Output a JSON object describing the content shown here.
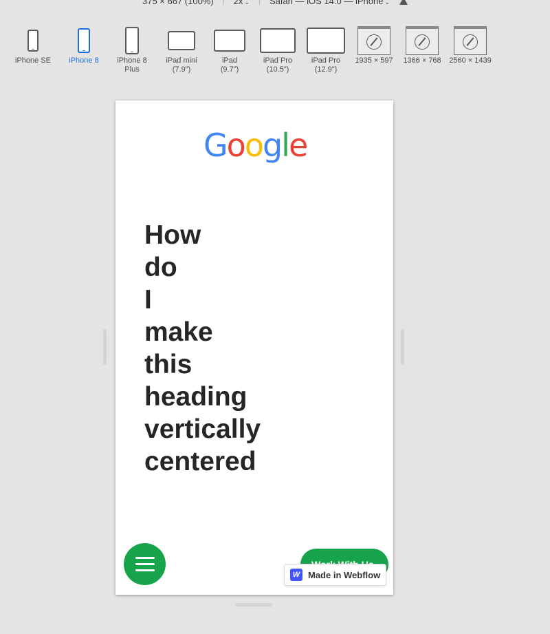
{
  "toolbar": {
    "dimensions": "375 × 667 (100%)",
    "scale": "2x",
    "browser": "Safari — iOS 14.0 — iPhone"
  },
  "devices": [
    {
      "label": "iPhone SE",
      "kind": "phone",
      "active": false
    },
    {
      "label": "iPhone 8",
      "kind": "phone",
      "active": true
    },
    {
      "label": "iPhone 8\nPlus",
      "kind": "phone",
      "active": false
    },
    {
      "label": "iPad mini\n(7.9\")",
      "kind": "tablet",
      "active": false
    },
    {
      "label": "iPad\n(9.7\")",
      "kind": "tablet",
      "active": false
    },
    {
      "label": "iPad Pro\n(10.5\")",
      "kind": "tablet",
      "active": false
    },
    {
      "label": "iPad Pro\n(12.9\")",
      "kind": "tablet",
      "active": false
    },
    {
      "label": "1935 × 597",
      "kind": "browser",
      "active": false
    },
    {
      "label": "1366 × 768",
      "kind": "browser",
      "active": false
    },
    {
      "label": "2560 × 1439",
      "kind": "browser",
      "active": false
    }
  ],
  "page": {
    "logo_letters": [
      {
        "char": "G",
        "color": "#4285F4"
      },
      {
        "char": "o",
        "color": "#EA4335"
      },
      {
        "char": "o",
        "color": "#FBBC05"
      },
      {
        "char": "g",
        "color": "#4285F4"
      },
      {
        "char": "l",
        "color": "#34A853"
      },
      {
        "char": "e",
        "color": "#EA4335"
      }
    ],
    "heading": "How do I make this heading vertically centered",
    "cta_label": "Work With Us",
    "badge_label": "Made in Webflow",
    "badge_logo": "W"
  },
  "colors": {
    "accent_active": "#1a6fe0",
    "button_green": "#17a349",
    "webflow_blue": "#4353ff"
  }
}
